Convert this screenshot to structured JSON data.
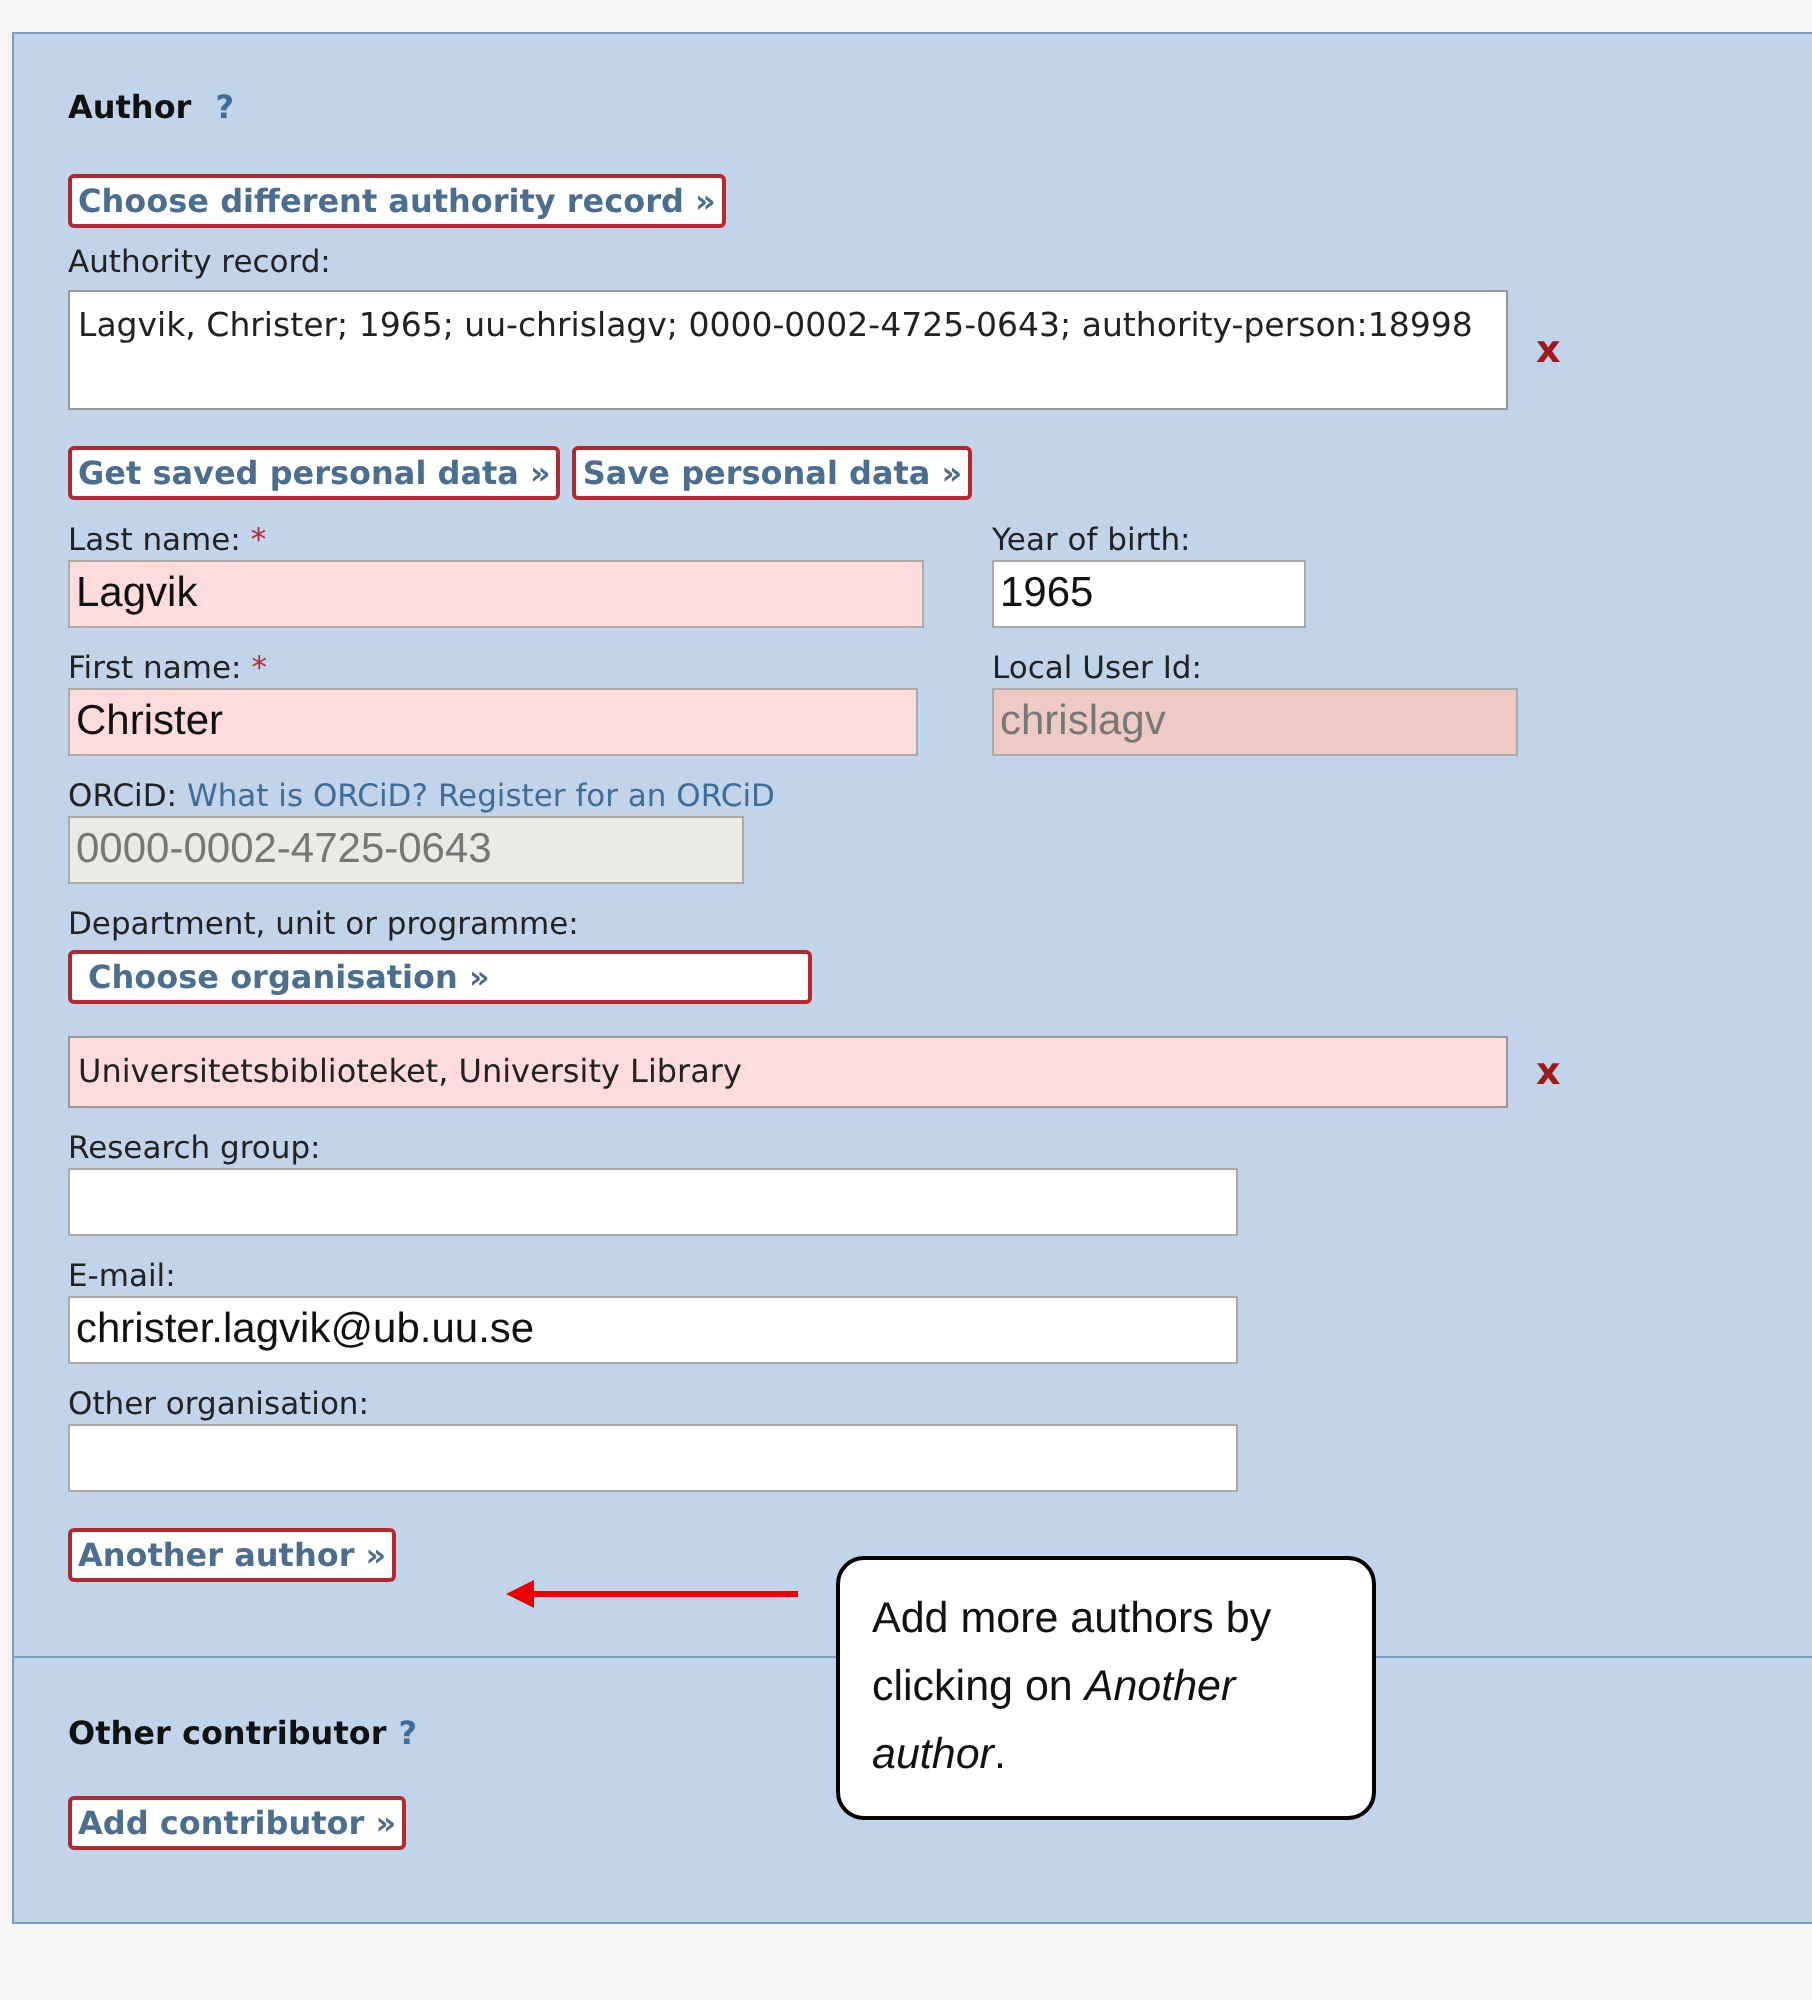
{
  "author": {
    "title": "Author",
    "help": "?",
    "choose_button": "Choose different authority record »",
    "authority": {
      "label": "Authority record:",
      "value": "Lagvik, Christer; 1965; uu-chrislagv; 0000-0002-4725-0643; authority-person:18998",
      "remove": "x"
    },
    "data_buttons": [
      "Get saved personal data »",
      "Save personal data »"
    ],
    "name_fields": [
      {
        "label": "Last name:",
        "mark": "*",
        "value": "Lagvik",
        "kind": "required"
      },
      {
        "label": "Year of birth:",
        "value": "1965",
        "kind": "plain"
      },
      {
        "label": "First name:",
        "mark": "*",
        "value": "Christer",
        "kind": "required"
      },
      {
        "label": "Local User Id:",
        "value": "chrislagv",
        "kind": "locked"
      }
    ],
    "orcid": {
      "label": "ORCiD:",
      "links": [
        "What is ORCiD?",
        "Register for an ORCiD"
      ],
      "value": "0000-0002-4725-0643",
      "kind": "readonly"
    },
    "department": {
      "label": "Department, unit or programme:",
      "button": "Choose organisation »",
      "value": "Universitetsbiblioteket, University Library",
      "remove": "x"
    },
    "extra_fields": [
      {
        "label": "Research group:"
      },
      {
        "label": "E-mail:",
        "value": "christer.lagvik@ub.uu.se"
      },
      {
        "label": "Other organisation:"
      }
    ],
    "another_button": "Another author »"
  },
  "callout": {
    "text": "Add more authors by clicking on *Another author*."
  },
  "other_contributor": {
    "title": "Other contributor",
    "help": "?",
    "button": "Add contributor »"
  }
}
